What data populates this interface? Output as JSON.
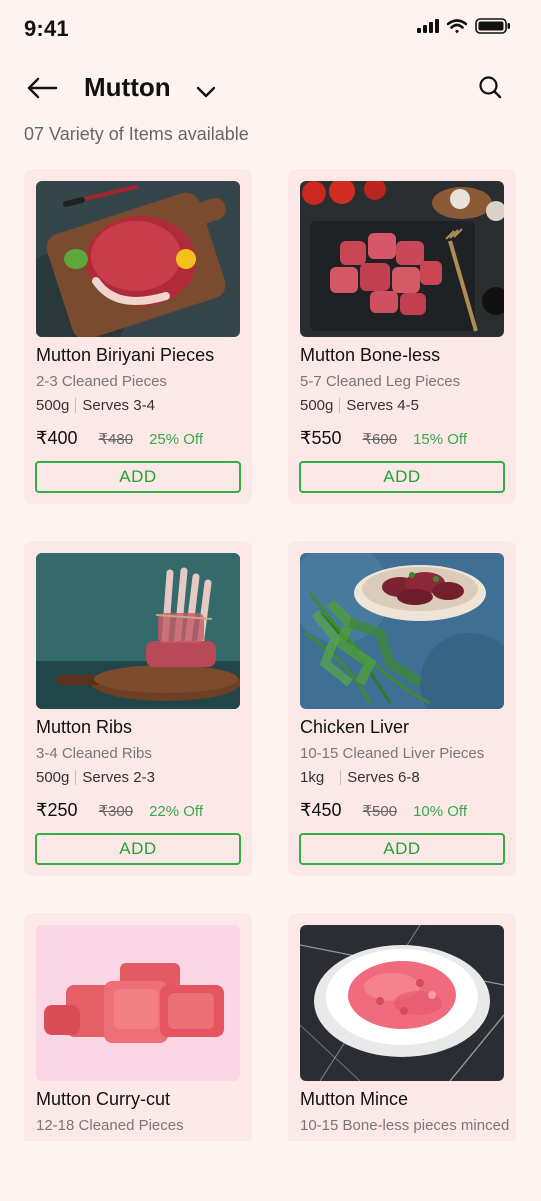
{
  "status_bar": {
    "time": "9:41"
  },
  "header": {
    "title": "Mutton",
    "back_icon": "arrow-left-icon",
    "dropdown_icon": "chevron-down-icon",
    "search_icon": "search-icon"
  },
  "subtitle": "07 Variety of Items available",
  "colors": {
    "background": "#fdf4f1",
    "card": "#fde8e8",
    "accent_green": "#33ad44",
    "discount_green": "#3aa84b"
  },
  "products": [
    {
      "name": "Mutton Biriyani Pieces",
      "description": "2-3 Cleaned Pieces",
      "weight": "500g",
      "serves": "Serves 3-4",
      "price": "₹400",
      "old_price": "₹480",
      "discount": "25% Off",
      "button": "ADD",
      "image_icon": "mutton-leg-board-image"
    },
    {
      "name": "Mutton Bone-less",
      "description": "5-7 Cleaned Leg Pieces",
      "weight": "500g",
      "serves": "Serves 4-5",
      "price": "₹550",
      "old_price": "₹600",
      "discount": "15% Off",
      "button": "ADD",
      "image_icon": "boneless-cubes-slate-image"
    },
    {
      "name": "Mutton Ribs",
      "description": "3-4 Cleaned Ribs",
      "weight": "500g",
      "serves": "Serves 2-3",
      "price": "₹250",
      "old_price": "₹300",
      "discount": "22% Off",
      "button": "ADD",
      "image_icon": "rack-of-ribs-image"
    },
    {
      "name": "Chicken Liver",
      "description": "10-15 Cleaned Liver Pieces",
      "weight": "1kg",
      "serves": "Serves 6-8",
      "price": "₹450",
      "old_price": "₹500",
      "discount": "10% Off",
      "button": "ADD",
      "image_icon": "liver-bowl-dill-image"
    },
    {
      "name": "Mutton Curry-cut",
      "description": "12-18 Cleaned Pieces",
      "weight": "",
      "serves": "",
      "price": "",
      "old_price": "",
      "discount": "",
      "button": "",
      "image_icon": "curry-cut-chunks-image"
    },
    {
      "name": "Mutton Mince",
      "description": "10-15 Bone-less pieces minced",
      "weight": "",
      "serves": "",
      "price": "",
      "old_price": "",
      "discount": "",
      "button": "",
      "image_icon": "minced-meat-plate-image"
    }
  ]
}
